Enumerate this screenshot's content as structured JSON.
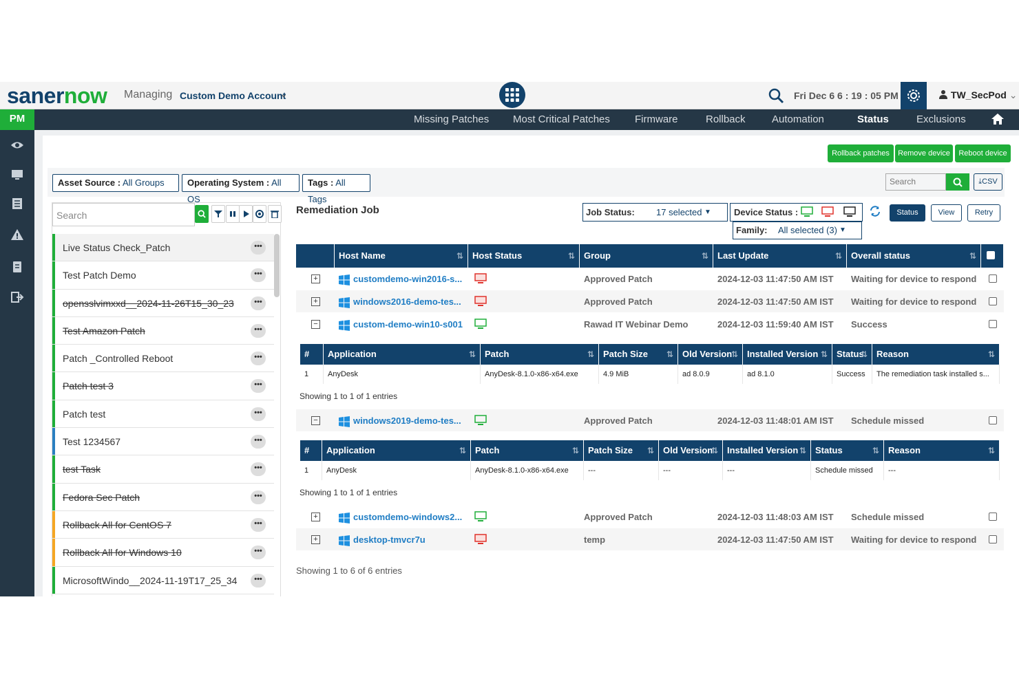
{
  "header": {
    "logo_part1": "saner",
    "logo_part2": "now",
    "managing_label": "Managing",
    "account": "Custom Demo Account",
    "datetime": "Fri Dec 6  6 : 19 : 05  PM",
    "user": "TW_SecPod"
  },
  "module": "PM",
  "nav": {
    "items": [
      "Missing Patches",
      "Most Critical Patches",
      "Firmware",
      "Rollback",
      "Automation",
      "Status",
      "Exclusions"
    ],
    "active": "Status"
  },
  "actions": {
    "rollback": "Rollback patches",
    "remove": "Remove device",
    "reboot": "Reboot device"
  },
  "filters": {
    "asset_source_label": "Asset Source :",
    "asset_source_value": "All Groups",
    "os_label": "Operating System :",
    "os_value": "All OS",
    "tags_label": "Tags :",
    "tags_value": "All Tags"
  },
  "table_search_placeholder": "Search",
  "csv_label": "CSV",
  "job_search_placeholder": "Search",
  "jobs": [
    {
      "name": "Live Status Check_Patch",
      "color": "#1fae39",
      "strike": false,
      "selected": true
    },
    {
      "name": "Test Patch Demo",
      "color": "#1fae39",
      "strike": false
    },
    {
      "name": "opensslvimxxd__2024-11-26T15_30_23",
      "color": "#1fae39",
      "strike": true
    },
    {
      "name": "Test Amazon Patch",
      "color": "#1fae39",
      "strike": true
    },
    {
      "name": "Patch _Controlled Reboot",
      "color": "#1fae39",
      "strike": false
    },
    {
      "name": "Patch test 3",
      "color": "#1fae39",
      "strike": true
    },
    {
      "name": "Patch test",
      "color": "#1fae39",
      "strike": false
    },
    {
      "name": "Test 1234567",
      "color": "#2a7fc0",
      "strike": false
    },
    {
      "name": "test Task",
      "color": "#1fae39",
      "strike": true
    },
    {
      "name": "Fedora Sec Patch",
      "color": "#1fae39",
      "strike": true
    },
    {
      "name": "Rollback All for CentOS 7",
      "color": "#f5a623",
      "strike": true
    },
    {
      "name": "Rollback All for Windows 10",
      "color": "#f5a623",
      "strike": true
    },
    {
      "name": "MicrosoftWindo__2024-11-19T17_25_34",
      "color": "#1fae39",
      "strike": false
    }
  ],
  "remediation": {
    "title": "Remediation Job",
    "job_status_label": "Job Status:",
    "job_status_value": "17 selected",
    "device_status_label": "Device Status :",
    "family_label": "Family:",
    "family_value": "All selected (3)",
    "btn_status": "Status",
    "btn_view": "View",
    "btn_retry": "Retry"
  },
  "table": {
    "headers": [
      "Host Name",
      "Host Status",
      "Group",
      "Last Update",
      "Overall status"
    ],
    "sub_headers_1": [
      "#",
      "Application",
      "Patch",
      "Patch Size",
      "Old Version",
      "Installed Version",
      "Status",
      "Reason"
    ],
    "rows": [
      {
        "host": "customdemo-win2016-s...",
        "status_color": "#e0322b",
        "group": "Approved Patch",
        "update": "2024-12-03 11:47:50 AM IST",
        "overall": "Waiting for device to respond",
        "exp": "+"
      },
      {
        "host": "windows2016-demo-tes...",
        "status_color": "#e0322b",
        "group": "Approved Patch",
        "update": "2024-12-03 11:47:50 AM IST",
        "overall": "Waiting for device to respond",
        "exp": "+"
      },
      {
        "host": "custom-demo-win10-s001",
        "status_color": "#1fae39",
        "group": "Rawad IT Webinar Demo",
        "update": "2024-12-03 11:59:40 AM IST",
        "overall": "Success",
        "exp": "−"
      },
      {
        "host": "windows2019-demo-tes...",
        "status_color": "#1fae39",
        "group": "Approved Patch",
        "update": "2024-12-03 11:48:01 AM IST",
        "overall": "Schedule missed",
        "exp": "−"
      },
      {
        "host": "customdemo-windows2...",
        "status_color": "#1fae39",
        "group": "Approved Patch",
        "update": "2024-12-03 11:48:03 AM IST",
        "overall": "Schedule missed",
        "exp": "+"
      },
      {
        "host": "desktop-tmvcr7u",
        "status_color": "#e0322b",
        "group": "temp",
        "update": "2024-12-03 11:47:50 AM IST",
        "overall": "Waiting for device to respond",
        "exp": "+"
      }
    ],
    "sub1": {
      "num": "1",
      "app": "AnyDesk",
      "patch": "AnyDesk-8.1.0-x86-x64.exe",
      "size": "4.9 MiB",
      "old": "ad 8.0.9",
      "installed": "ad 8.1.0",
      "status": "Success",
      "reason": "The remediation task installed s..."
    },
    "sub2": {
      "num": "1",
      "app": "AnyDesk",
      "patch": "AnyDesk-8.1.0-x86-x64.exe",
      "size": "---",
      "old": "---",
      "installed": "---",
      "status": "Schedule missed",
      "reason": "---"
    },
    "sub_showing": "Showing 1 to 1 of 1 entries",
    "showing": "Showing 1 to 6 of 6 entries"
  }
}
